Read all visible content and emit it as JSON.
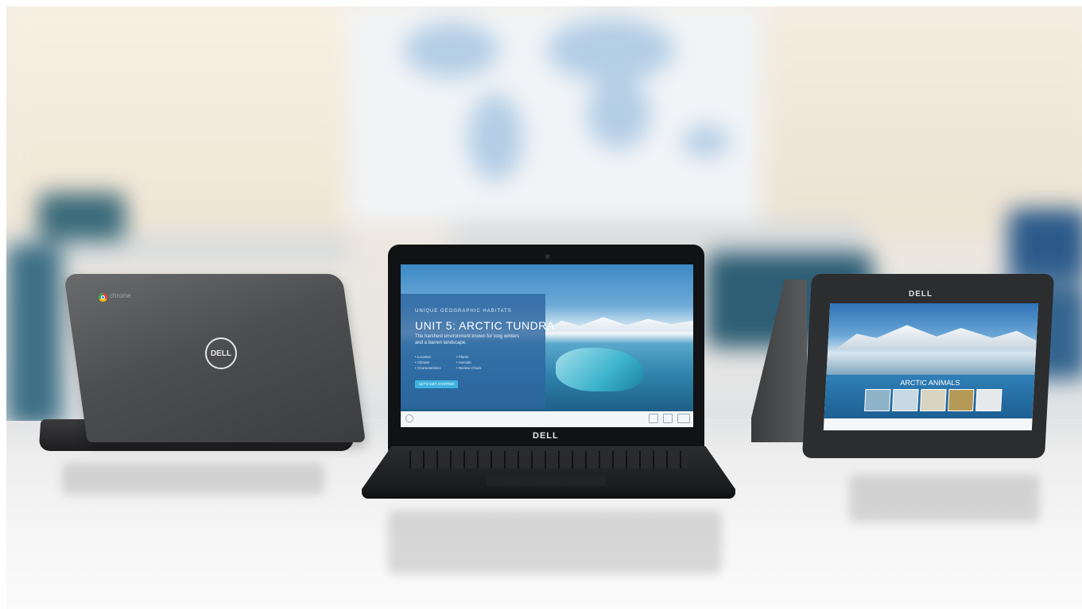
{
  "scene": {
    "description_tags": [
      "classroom-background",
      "white-table"
    ]
  },
  "left_device": {
    "brand_badge": "DELL",
    "os_label": "chrome"
  },
  "center_device": {
    "brand": "DELL",
    "screen": {
      "kicker": "UNIQUE GEOGRAPHIC HABITATS",
      "title": "UNIT 5: ARCTIC TUNDRA",
      "description": "The harshest environment known for long winters and a barren landscape.",
      "bullets_left": [
        "• Location",
        "• Climate",
        "• Characteristics"
      ],
      "bullets_right": [
        "• Plants",
        "• Animals",
        "• Review Check"
      ],
      "button": "LET'S GET STARTED"
    }
  },
  "right_device": {
    "brand": "DELL",
    "screen": {
      "heading": "ARCTIC ANIMALS"
    }
  },
  "colors": {
    "panel_blue": "#2e67a0",
    "button_cyan": "#3fb3df",
    "device_dark": "#1a1b1c"
  }
}
